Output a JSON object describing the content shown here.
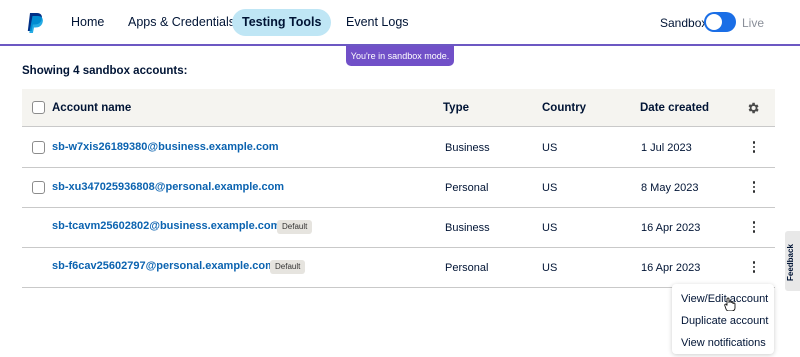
{
  "header": {
    "logo_icon": "paypal-logo-icon",
    "nav": [
      {
        "label": "Home",
        "active": false
      },
      {
        "label": "Apps & Credentials",
        "active": false
      },
      {
        "label": "Testing Tools",
        "active": true
      },
      {
        "label": "Event Logs",
        "active": false
      }
    ],
    "mode_toggle": {
      "left_label": "Sandbox",
      "right_label": "Live",
      "selected": "Sandbox"
    }
  },
  "banner": {
    "text": "You're in sandbox mode."
  },
  "summary": {
    "text": "Showing 4 sandbox accounts:"
  },
  "table": {
    "columns": [
      "Account name",
      "Type",
      "Country",
      "Date created"
    ],
    "settings_icon": "gear-icon",
    "rows": [
      {
        "account": "sb-w7xis26189380@business.example.com",
        "badge": "",
        "type": "Business",
        "country": "US",
        "date": "1 Jul 2023",
        "has_checkbox": true
      },
      {
        "account": "sb-xu347025936808@personal.example.com",
        "badge": "",
        "type": "Personal",
        "country": "US",
        "date": "8 May 2023",
        "has_checkbox": true
      },
      {
        "account": "sb-tcavm25602802@business.example.com",
        "badge": "Default",
        "type": "Business",
        "country": "US",
        "date": "16 Apr 2023",
        "has_checkbox": false
      },
      {
        "account": "sb-f6cav25602797@personal.example.com",
        "badge": "Default",
        "type": "Personal",
        "country": "US",
        "date": "16 Apr 2023",
        "has_checkbox": false
      }
    ]
  },
  "row_menu": {
    "items": [
      "View/Edit account",
      "Duplicate account",
      "View notifications"
    ]
  },
  "feedback": {
    "label": "Feedback"
  },
  "colors": {
    "accent_purple": "#6c58c3",
    "banner_purple": "#7150c8",
    "active_tab_bg": "#bfe6f5",
    "link_blue": "#0b63b0",
    "toggle_blue": "#1a6ee6",
    "header_row_bg": "#f5f4f0"
  }
}
